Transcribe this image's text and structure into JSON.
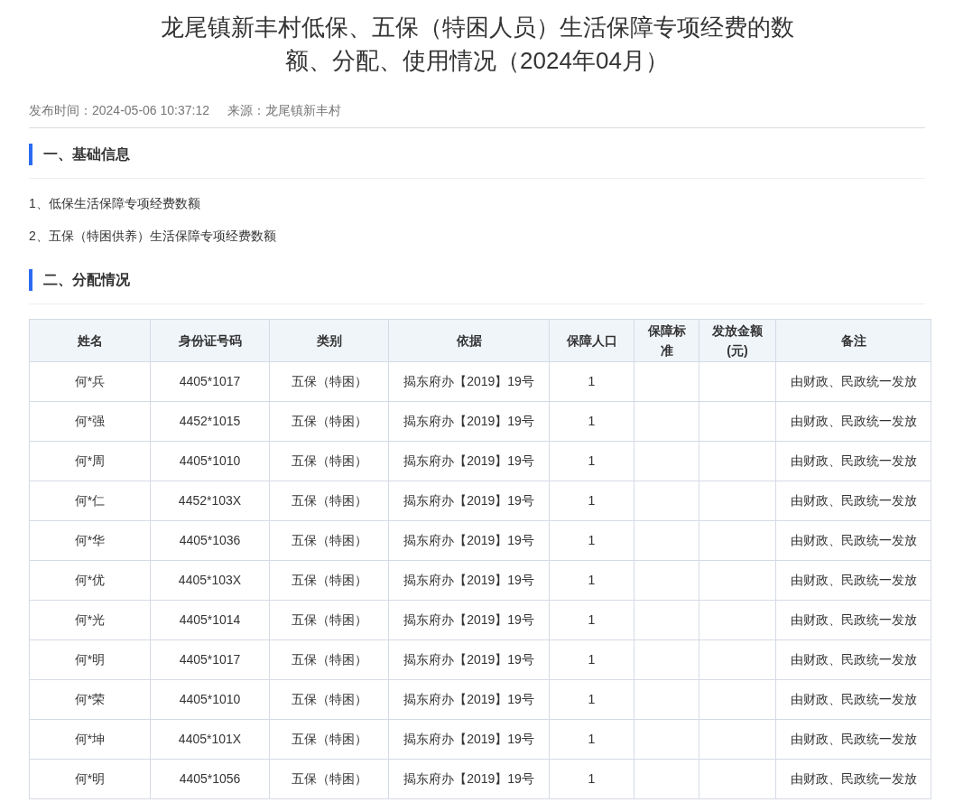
{
  "title": "龙尾镇新丰村低保、五保（特困人员）生活保障专项经费的数额、分配、使用情况（2024年04月）",
  "meta": {
    "publish_time": "发布时间：2024-05-06 10:37:12",
    "source": "来源：龙尾镇新丰村"
  },
  "sections": [
    {
      "heading": "一、基础信息",
      "items": [
        "1、低保生活保障专项经费数额",
        "2、五保（特困供养）生活保障专项经费数额"
      ]
    },
    {
      "heading": "二、分配情况",
      "table": {
        "columns": [
          "姓名",
          "身份证号码",
          "类别",
          "依据",
          "保障人口",
          "保障标准",
          "发放金额(元)",
          "备注"
        ],
        "rows": [
          [
            "何*兵",
            "4405*1017",
            "五保（特困）",
            "揭东府办【2019】19号",
            "1",
            null,
            null,
            "由财政、民政统一发放"
          ],
          [
            "何*强",
            "4452*1015",
            "五保（特困）",
            "揭东府办【2019】19号",
            "1",
            null,
            null,
            "由财政、民政统一发放"
          ],
          [
            "何*周",
            "4405*1010",
            "五保（特困）",
            "揭东府办【2019】19号",
            "1",
            null,
            null,
            "由财政、民政统一发放"
          ],
          [
            "何*仁",
            "4452*103X",
            "五保（特困）",
            "揭东府办【2019】19号",
            "1",
            null,
            null,
            "由财政、民政统一发放"
          ],
          [
            "何*华",
            "4405*1036",
            "五保（特困）",
            "揭东府办【2019】19号",
            "1",
            null,
            null,
            "由财政、民政统一发放"
          ],
          [
            "何*优",
            "4405*103X",
            "五保（特困）",
            "揭东府办【2019】19号",
            "1",
            null,
            null,
            "由财政、民政统一发放"
          ],
          [
            "何*光",
            "4405*1014",
            "五保（特困）",
            "揭东府办【2019】19号",
            "1",
            null,
            null,
            "由财政、民政统一发放"
          ],
          [
            "何*明",
            "4405*1017",
            "五保（特困）",
            "揭东府办【2019】19号",
            "1",
            null,
            null,
            "由财政、民政统一发放"
          ],
          [
            "何*荣",
            "4405*1010",
            "五保（特困）",
            "揭东府办【2019】19号",
            "1",
            null,
            null,
            "由财政、民政统一发放"
          ],
          [
            "何*坤",
            "4405*101X",
            "五保（特困）",
            "揭东府办【2019】19号",
            "1",
            null,
            null,
            "由财政、民政统一发放"
          ],
          [
            "何*明",
            "4405*1056",
            "五保（特困）",
            "揭东府办【2019】19号",
            "1",
            null,
            null,
            "由财政、民政统一发放"
          ]
        ]
      }
    }
  ]
}
